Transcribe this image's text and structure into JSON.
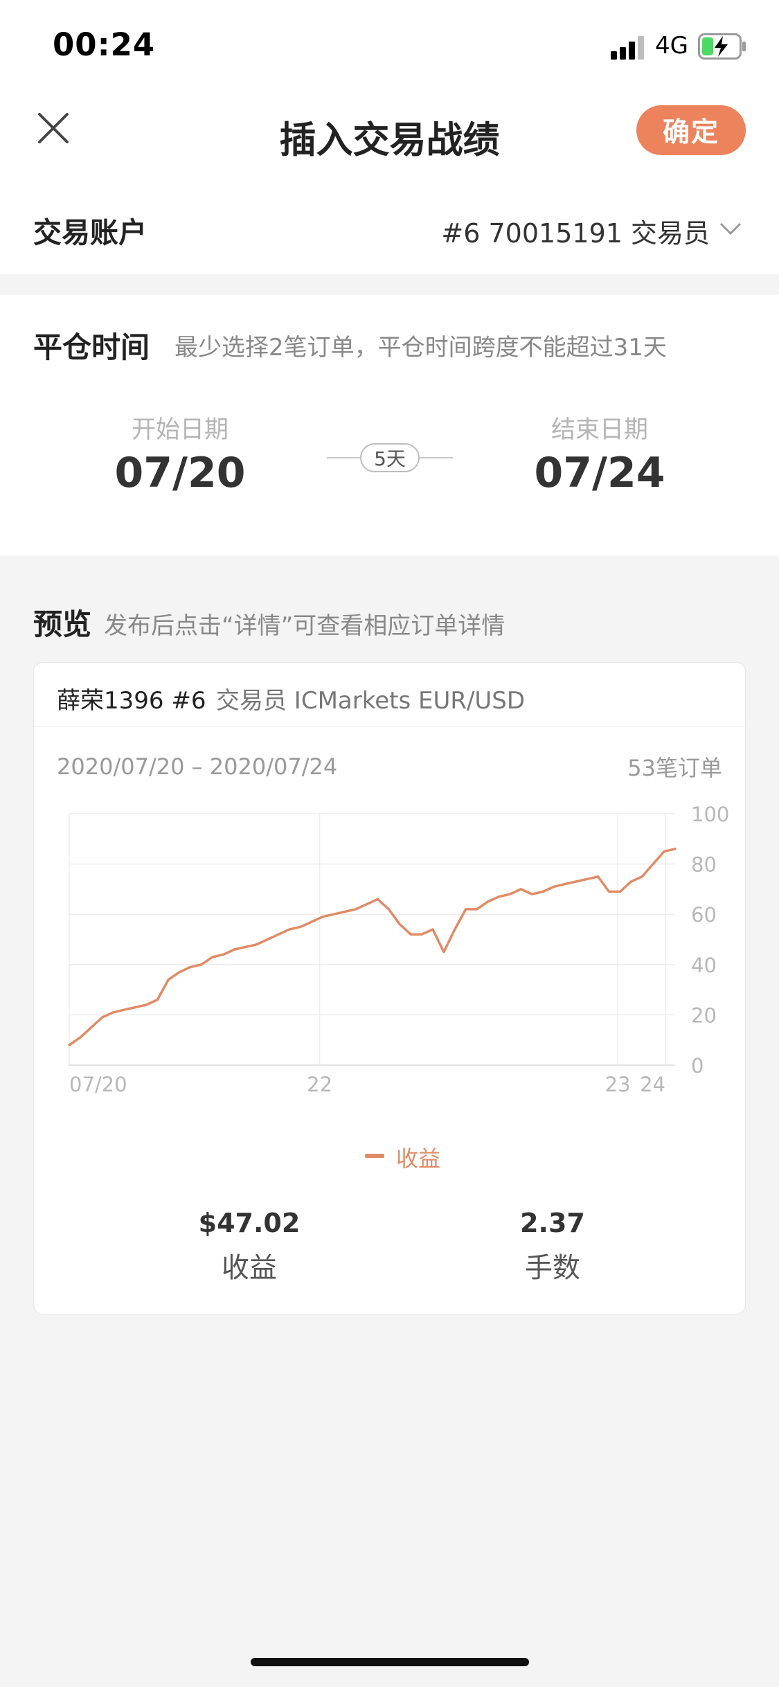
{
  "status_bar": {
    "time": "00:24",
    "network": "4G"
  },
  "header": {
    "title": "插入交易战绩",
    "confirm_label": "确定"
  },
  "account": {
    "label": "交易账户",
    "value": "#6 70015191 交易员"
  },
  "close_time": {
    "title": "平仓时间",
    "hint": "最少选择2笔订单，平仓时间跨度不能超过31天",
    "start_label": "开始日期",
    "start_value": "07/20",
    "end_label": "结束日期",
    "end_value": "07/24",
    "span": "5天"
  },
  "preview": {
    "title": "预览",
    "hint": "发布后点击“详情”可查看相应订单详情",
    "card": {
      "name": "薛荣1396 #6",
      "meta": "交易员 ICMarkets EUR/USD",
      "date_range": "2020/07/20 – 2020/07/24",
      "order_count": "53笔订单",
      "legend": "收益",
      "stats": [
        {
          "value": "$47.02",
          "label": "收益"
        },
        {
          "value": "2.37",
          "label": "手数"
        }
      ]
    }
  },
  "colors": {
    "accent": "#ec835d",
    "line": "#e08b66"
  },
  "chart_data": {
    "type": "line",
    "x_tick_labels": [
      "07/20",
      "22",
      "23",
      "24"
    ],
    "y_tick_labels": [
      "0",
      "20",
      "40",
      "60",
      "80",
      "100"
    ],
    "ylim": [
      0,
      100
    ],
    "x_range": [
      0,
      53
    ],
    "grid": true,
    "legend_position": "bottom",
    "series": [
      {
        "name": "收益",
        "values": [
          8,
          11,
          15,
          19,
          21,
          22,
          23,
          24,
          26,
          34,
          37,
          39,
          40,
          43,
          44,
          46,
          47,
          48,
          50,
          52,
          54,
          55,
          57,
          59,
          60,
          61,
          62,
          64,
          66,
          62,
          56,
          52,
          52,
          54,
          45,
          54,
          62,
          62,
          65,
          67,
          68,
          70,
          68,
          69,
          71,
          72,
          73,
          74,
          75,
          69,
          69,
          73,
          75,
          80,
          85,
          86
        ]
      }
    ]
  }
}
